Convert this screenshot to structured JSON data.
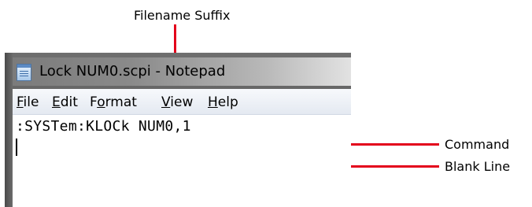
{
  "annotations": {
    "filename_suffix": "Filename Suffix",
    "command": "Command",
    "blank_line": "Blank Line"
  },
  "colors": {
    "annotation_arrow": "#e3001b",
    "menu_bar": "#e4e9f1",
    "title_bar": "#8a8a8a"
  },
  "window": {
    "icon": "notepad-icon",
    "title": "Lock NUM0.scpi - Notepad",
    "menu": [
      {
        "mnemonic": "F",
        "rest": "ile"
      },
      {
        "mnemonic": "E",
        "rest": "dit"
      },
      {
        "before": "F",
        "mnemonic": "o",
        "rest": "rmat"
      },
      {
        "mnemonic": "V",
        "rest": "iew"
      },
      {
        "mnemonic": "H",
        "rest": "elp"
      }
    ],
    "content": {
      "line1": ":SYSTem:KLOCk NUM0,1",
      "line2": ""
    }
  }
}
